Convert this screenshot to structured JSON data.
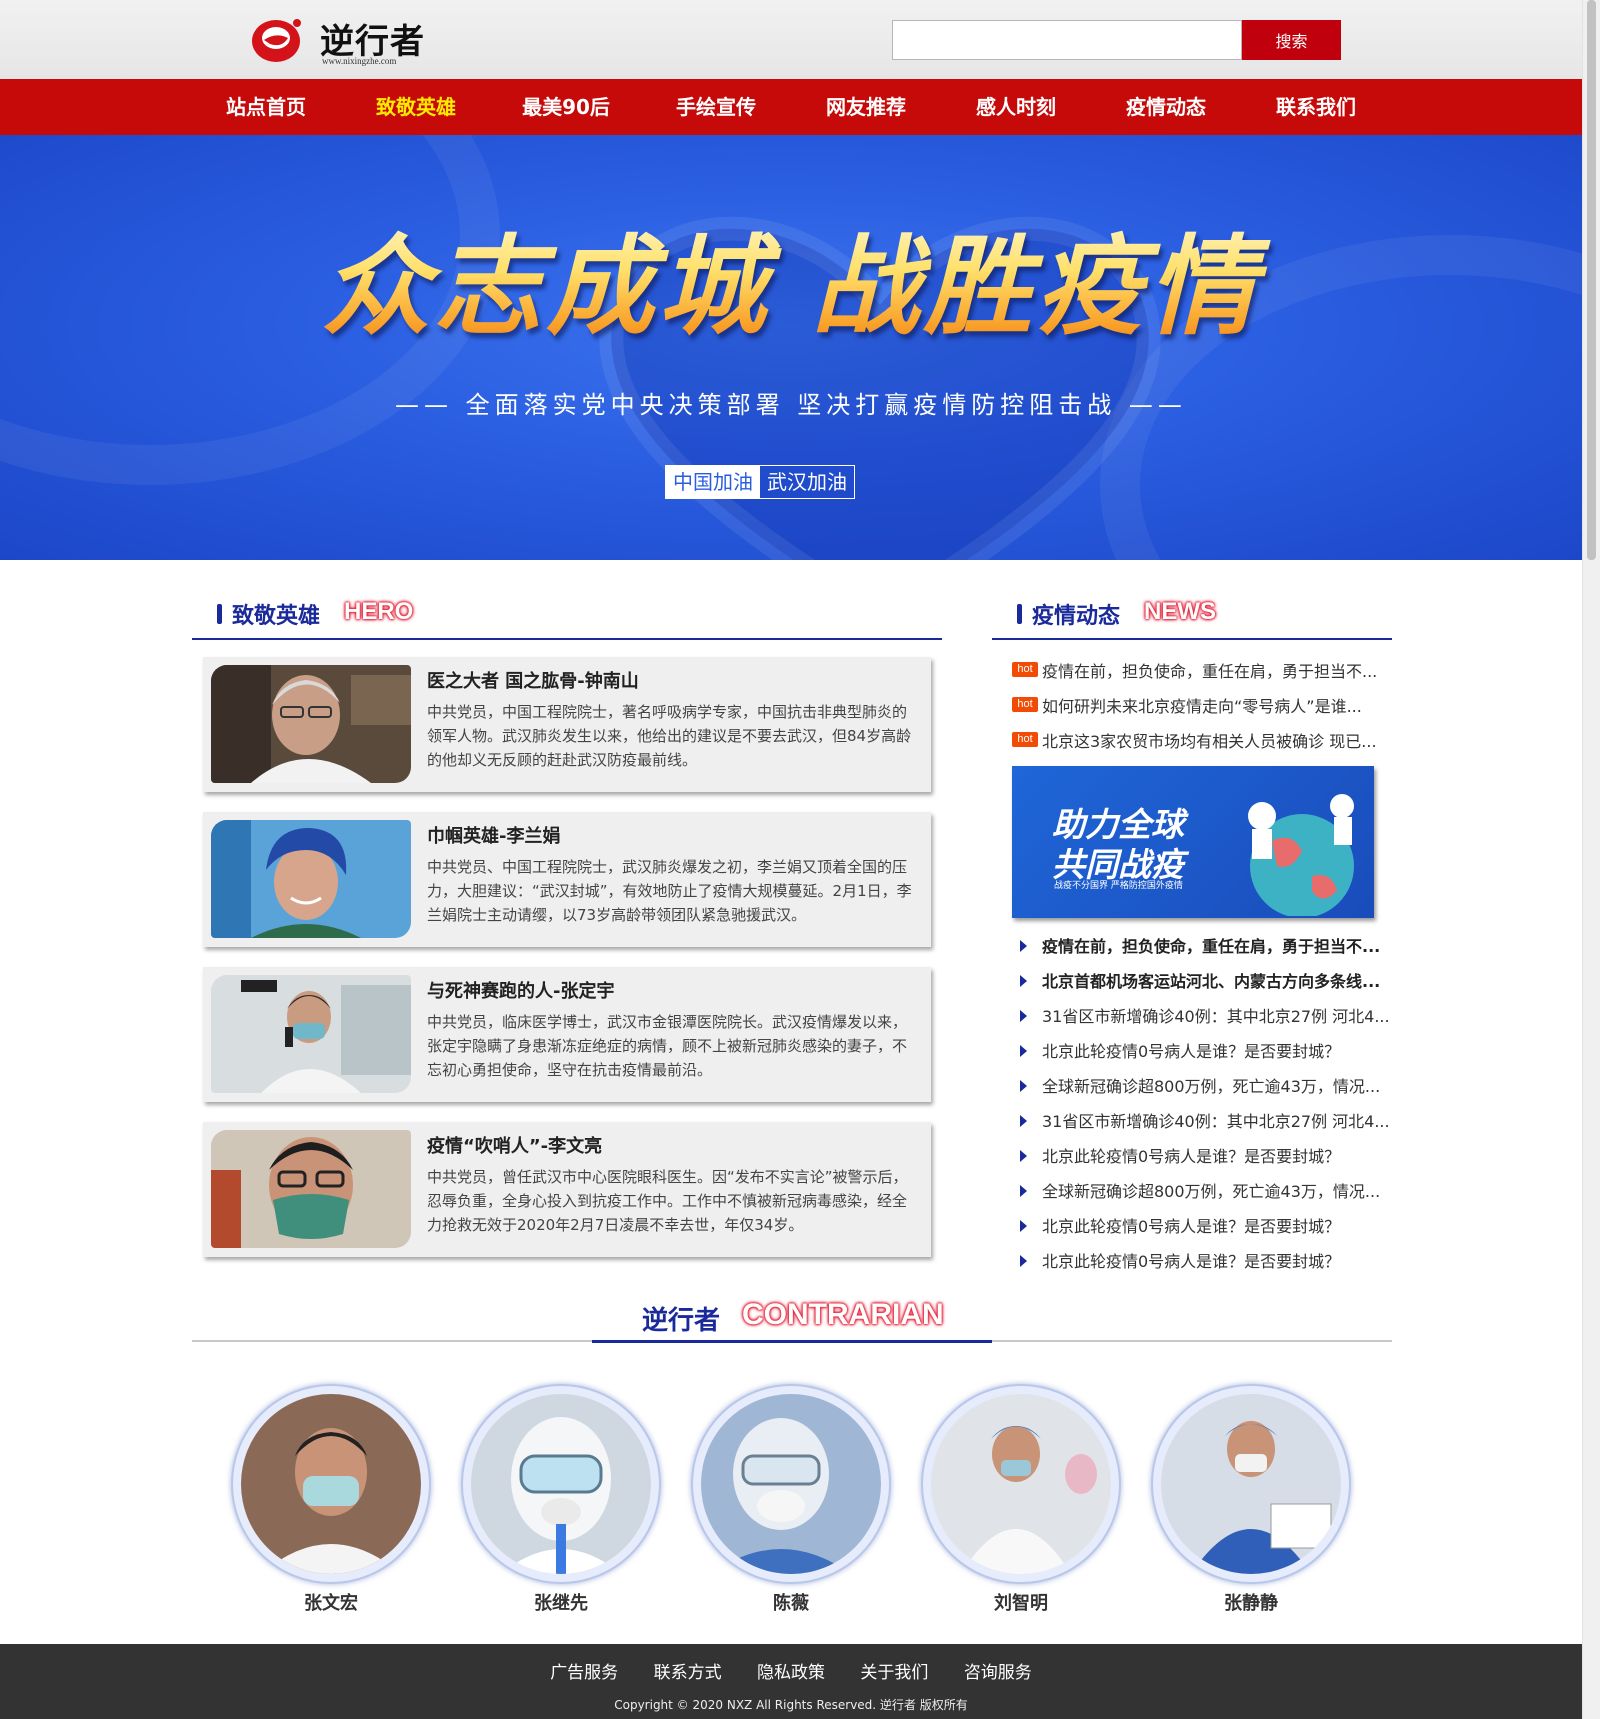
{
  "header": {
    "logo_name": "逆行者",
    "logo_url": "www.nixingzhe.com",
    "search_placeholder": "",
    "search_label": "搜索"
  },
  "nav": {
    "items": [
      {
        "label": "站点首页",
        "active": false
      },
      {
        "label": "致敬英雄",
        "active": true
      },
      {
        "label": "最美90后",
        "active": false
      },
      {
        "label": "手绘宣传",
        "active": false
      },
      {
        "label": "网友推荐",
        "active": false
      },
      {
        "label": "感人时刻",
        "active": false
      },
      {
        "label": "疫情动态",
        "active": false
      },
      {
        "label": "联系我们",
        "active": false
      }
    ]
  },
  "banner": {
    "headline": "众志成城 战胜疫情",
    "subline": "—— 全面落实党中央决策部署  坚决打赢疫情防控阻击战 ——",
    "badge_left": "中国加油",
    "badge_right": "武汉加油"
  },
  "heroes": {
    "title_cn": "致敬英雄",
    "title_en": "HERO",
    "items": [
      {
        "title": "医之大者 国之肱骨-钟南山",
        "desc": "中共党员，中国工程院院士，著名呼吸病学专家，中国抗击非典型肺炎的领军人物。武汉肺炎发生以来，他给出的建议是不要去武汉，但84岁高龄的他却义无反顾的赶赴武汉防疫最前线。"
      },
      {
        "title": "巾帼英雄-李兰娟",
        "desc": "中共党员、中国工程院院士，武汉肺炎爆发之初，李兰娟又顶着全国的压力，大胆建议：“武汉封城”，有效地防止了疫情大规模蔓延。2月1日，李兰娟院士主动请缨，以73岁高龄带领团队紧急驰援武汉。"
      },
      {
        "title": "与死神赛跑的人-张定宇",
        "desc": "中共党员，临床医学博士，武汉市金银潭医院院长。武汉疫情爆发以来，张定宇隐瞒了身患渐冻症绝症的病情，顾不上被新冠肺炎感染的妻子，不忘初心勇担使命，坚守在抗击疫情最前沿。"
      },
      {
        "title": "疫情“吹哨人”-李文亮",
        "desc": "中共党员，曾任武汉市中心医院眼科医生。因“发布不实言论”被警示后，忍辱负重，全身心投入到抗疫工作中。工作中不慎被新冠病毒感染，经全力抢救无效于2020年2月7日凌晨不幸去世，年仅34岁。"
      }
    ]
  },
  "news": {
    "title_cn": "疫情动态",
    "title_en": "NEWS",
    "hot_tag": "hot",
    "hot_items": [
      "疫情在前，担负使命，重任在肩，勇于担当不...",
      "如何研判未来北京疫情走向“零号病人”是谁...",
      "北京这3家农贸市场均有相关人员被确诊 现已..."
    ],
    "ad": {
      "line1": "助力全球",
      "line2": "共同战疫",
      "small": "战疫不分国界 严格防控国外疫情"
    },
    "items": [
      {
        "text": "疫情在前，担负使命，重任在肩，勇于担当不...",
        "bold": true
      },
      {
        "text": "北京首都机场客运站河北、内蒙古方向多条线...",
        "bold": true
      },
      {
        "text": "31省区市新增确诊40例：其中北京27例 河北4...",
        "bold": false
      },
      {
        "text": "北京此轮疫情0号病人是谁？是否要封城？",
        "bold": false
      },
      {
        "text": "全球新冠确诊超800万例，死亡逾43万，情况...",
        "bold": false
      },
      {
        "text": "31省区市新增确诊40例：其中北京27例 河北4...",
        "bold": false
      },
      {
        "text": "北京此轮疫情0号病人是谁？是否要封城？",
        "bold": false
      },
      {
        "text": "全球新冠确诊超800万例，死亡逾43万，情况...",
        "bold": false
      },
      {
        "text": "北京此轮疫情0号病人是谁？是否要封城？",
        "bold": false
      },
      {
        "text": "北京此轮疫情0号病人是谁？是否要封城？",
        "bold": false
      }
    ]
  },
  "contrarian": {
    "title_cn": "逆行者",
    "title_en": "CONTRARIAN",
    "people": [
      "张文宏",
      "张继先",
      "陈薇",
      "刘智明",
      "张静静"
    ]
  },
  "footer": {
    "links": [
      "广告服务",
      "联系方式",
      "隐私政策",
      "关于我们",
      "咨询服务"
    ],
    "copyright": "Copyright © 2020 NXZ All Rights Reserved. 逆行者 版权所有"
  },
  "colors": {
    "nav_bg": "#c60a0a",
    "nav_active": "#ffea00",
    "accent_blue": "#1b2a9a",
    "banner_blue": "#2a5de0",
    "hot_tag": "#f14b05",
    "footer_bg": "#333333"
  }
}
